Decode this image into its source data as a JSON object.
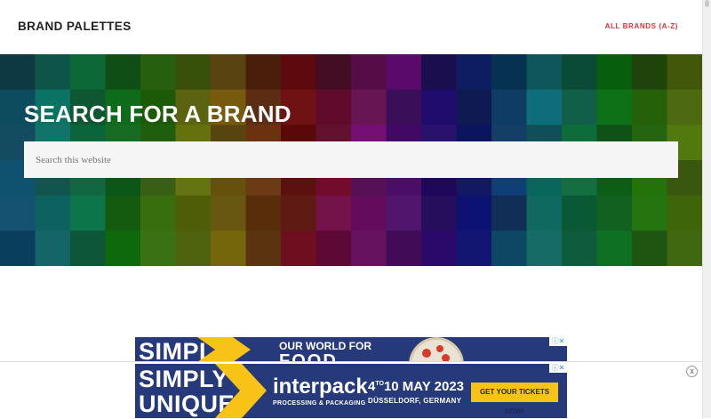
{
  "header": {
    "site_title": "BRAND PALETTES",
    "nav_link": "ALL BRANDS (A-Z)",
    "accent_color": "#e0323c"
  },
  "hero": {
    "title": "SEARCH FOR A BRAND",
    "search_placeholder": "Search this website"
  },
  "ads": {
    "inline": {
      "left_text": "SIMPLY",
      "headline": "OUR WORLD FOR",
      "headline2": "FOOD",
      "choices_icon": "adchoices-icon"
    },
    "sticky": {
      "left_line1": "SIMPLY",
      "left_line2": "UNIQUE",
      "brand": "interpack",
      "brand_sub": "PROCESSING & PACKAGING",
      "date_day": "4",
      "date_sup": "TO",
      "date_rest": "10 MAY 2023",
      "city": "DÜSSELDORF, GERMANY",
      "cta": "GET YOUR TICKETS NOW!",
      "choices_icon": "adchoices-icon",
      "close_icon": "close-icon",
      "close_glyph": "x",
      "bg_color": "#26397a",
      "cta_color": "#f7c316"
    }
  }
}
